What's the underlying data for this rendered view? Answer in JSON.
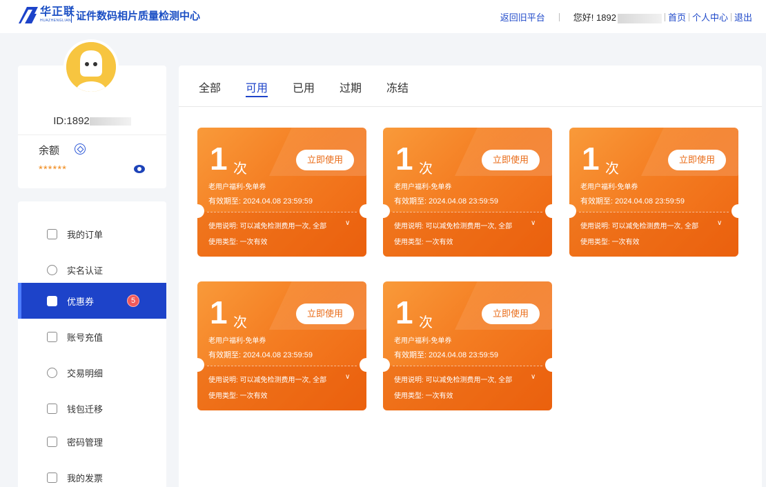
{
  "header": {
    "brand_cn": "华正联",
    "brand_en": "HUAZHENGLIAN",
    "site_title": "证件数码相片质量检测中心",
    "return_old": "返回旧平台",
    "greeting": "您好! 1892",
    "home": "首页",
    "personal_center": "个人中心",
    "logout": "退出",
    "brand_color": "#1d43c9"
  },
  "user": {
    "id_prefix": "ID:1892",
    "balance_label": "余额",
    "balance_value": "******"
  },
  "nav": {
    "items": [
      {
        "label": "我的订单",
        "icon": "order-icon"
      },
      {
        "label": "实名认证",
        "icon": "shield-check-icon"
      },
      {
        "label": "优惠券",
        "icon": "coupon-icon",
        "badge": "5",
        "active": true
      },
      {
        "label": "账号充值",
        "icon": "wallet-icon"
      },
      {
        "label": "交易明细",
        "icon": "chart-icon"
      },
      {
        "label": "钱包迁移",
        "icon": "wallet-transfer-icon"
      },
      {
        "label": "密码管理",
        "icon": "lock-icon"
      },
      {
        "label": "我的发票",
        "icon": "invoice-icon"
      }
    ]
  },
  "tabs": [
    {
      "label": "全部"
    },
    {
      "label": "可用",
      "active": true
    },
    {
      "label": "已用"
    },
    {
      "label": "过期"
    },
    {
      "label": "冻结"
    }
  ],
  "coupons": [
    {
      "count": "1",
      "unit": "次",
      "button": "立即使用",
      "name": "老用户福利-免单券",
      "valid": "有效期至: 2024.04.08 23:59:59",
      "desc": "使用说明: 可以减免检测费用一次, 全部",
      "type": "使用类型: 一次有效"
    },
    {
      "count": "1",
      "unit": "次",
      "button": "立即使用",
      "name": "老用户福利-免单券",
      "valid": "有效期至: 2024.04.08 23:59:59",
      "desc": "使用说明: 可以减免检测费用一次, 全部",
      "type": "使用类型: 一次有效"
    },
    {
      "count": "1",
      "unit": "次",
      "button": "立即使用",
      "name": "老用户福利-免单券",
      "valid": "有效期至: 2024.04.08 23:59:59",
      "desc": "使用说明: 可以减免检测费用一次, 全部",
      "type": "使用类型: 一次有效"
    },
    {
      "count": "1",
      "unit": "次",
      "button": "立即使用",
      "name": "老用户福利-免单券",
      "valid": "有效期至: 2024.04.08 23:59:59",
      "desc": "使用说明: 可以减免检测费用一次, 全部",
      "type": "使用类型: 一次有效"
    },
    {
      "count": "1",
      "unit": "次",
      "button": "立即使用",
      "name": "老用户福利-免单券",
      "valid": "有效期至: 2024.04.08 23:59:59",
      "desc": "使用说明: 可以减免检测费用一次, 全部",
      "type": "使用类型: 一次有效"
    }
  ]
}
